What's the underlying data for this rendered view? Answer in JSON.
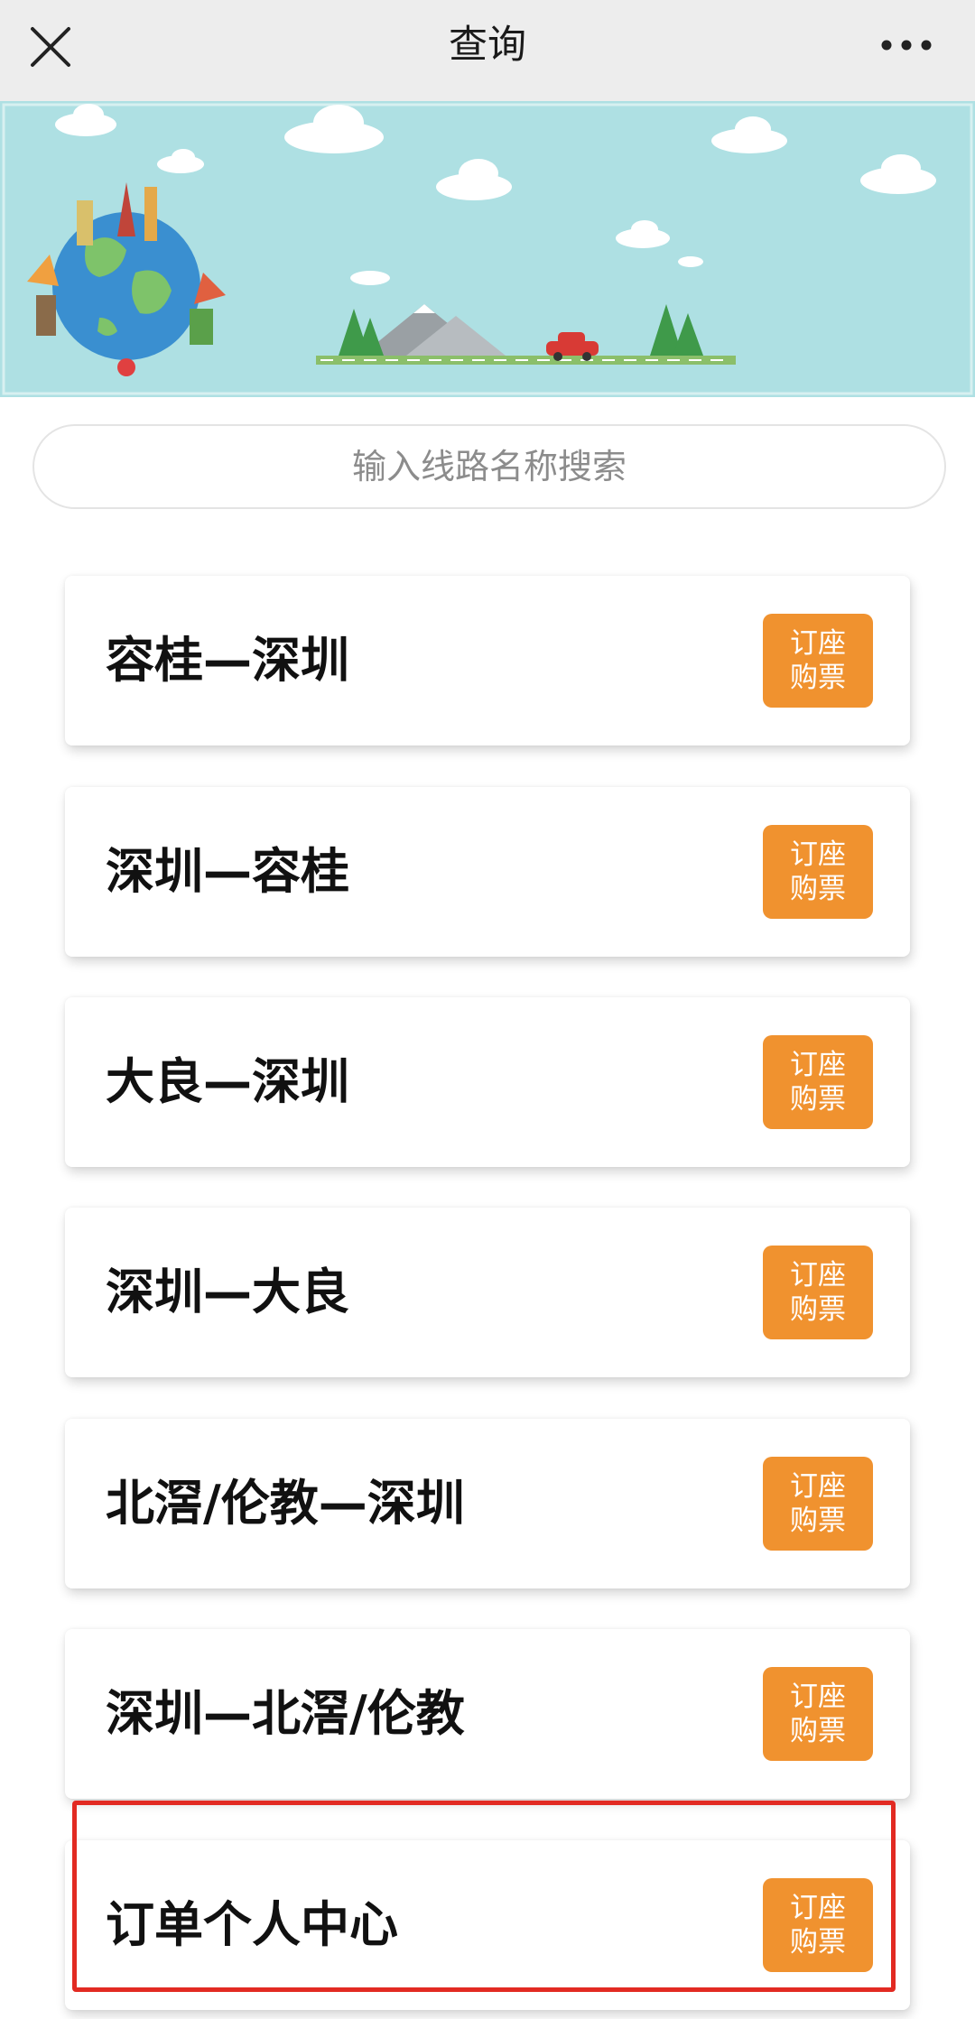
{
  "header": {
    "title": "查询",
    "close_icon": "close-icon",
    "more_icon": "more-dots-icon"
  },
  "banner": {
    "description_icons": [
      "globe-landmarks-illustration",
      "cloud-icon",
      "tree-icon",
      "mountain-icon",
      "red-car-icon"
    ],
    "sky_color": "#aee0e3"
  },
  "search": {
    "placeholder": "输入线路名称搜索"
  },
  "routes": [
    {
      "name": "容桂—深圳",
      "button_line1": "订座",
      "button_line2": "购票"
    },
    {
      "name": "深圳—容桂",
      "button_line1": "订座",
      "button_line2": "购票"
    },
    {
      "name": "大良—深圳",
      "button_line1": "订座",
      "button_line2": "购票"
    },
    {
      "name": "深圳—大良",
      "button_line1": "订座",
      "button_line2": "购票"
    },
    {
      "name": "北滘/伦教—深圳",
      "button_line1": "订座",
      "button_line2": "购票"
    },
    {
      "name": "深圳—北滘/伦教",
      "button_line1": "订座",
      "button_line2": "购票"
    },
    {
      "name": "订单个人中心",
      "button_line1": "订座",
      "button_line2": "购票"
    }
  ],
  "colors": {
    "accent_button": "#f0922f",
    "highlight_border": "#e22a22",
    "topbar": "#ededed"
  }
}
